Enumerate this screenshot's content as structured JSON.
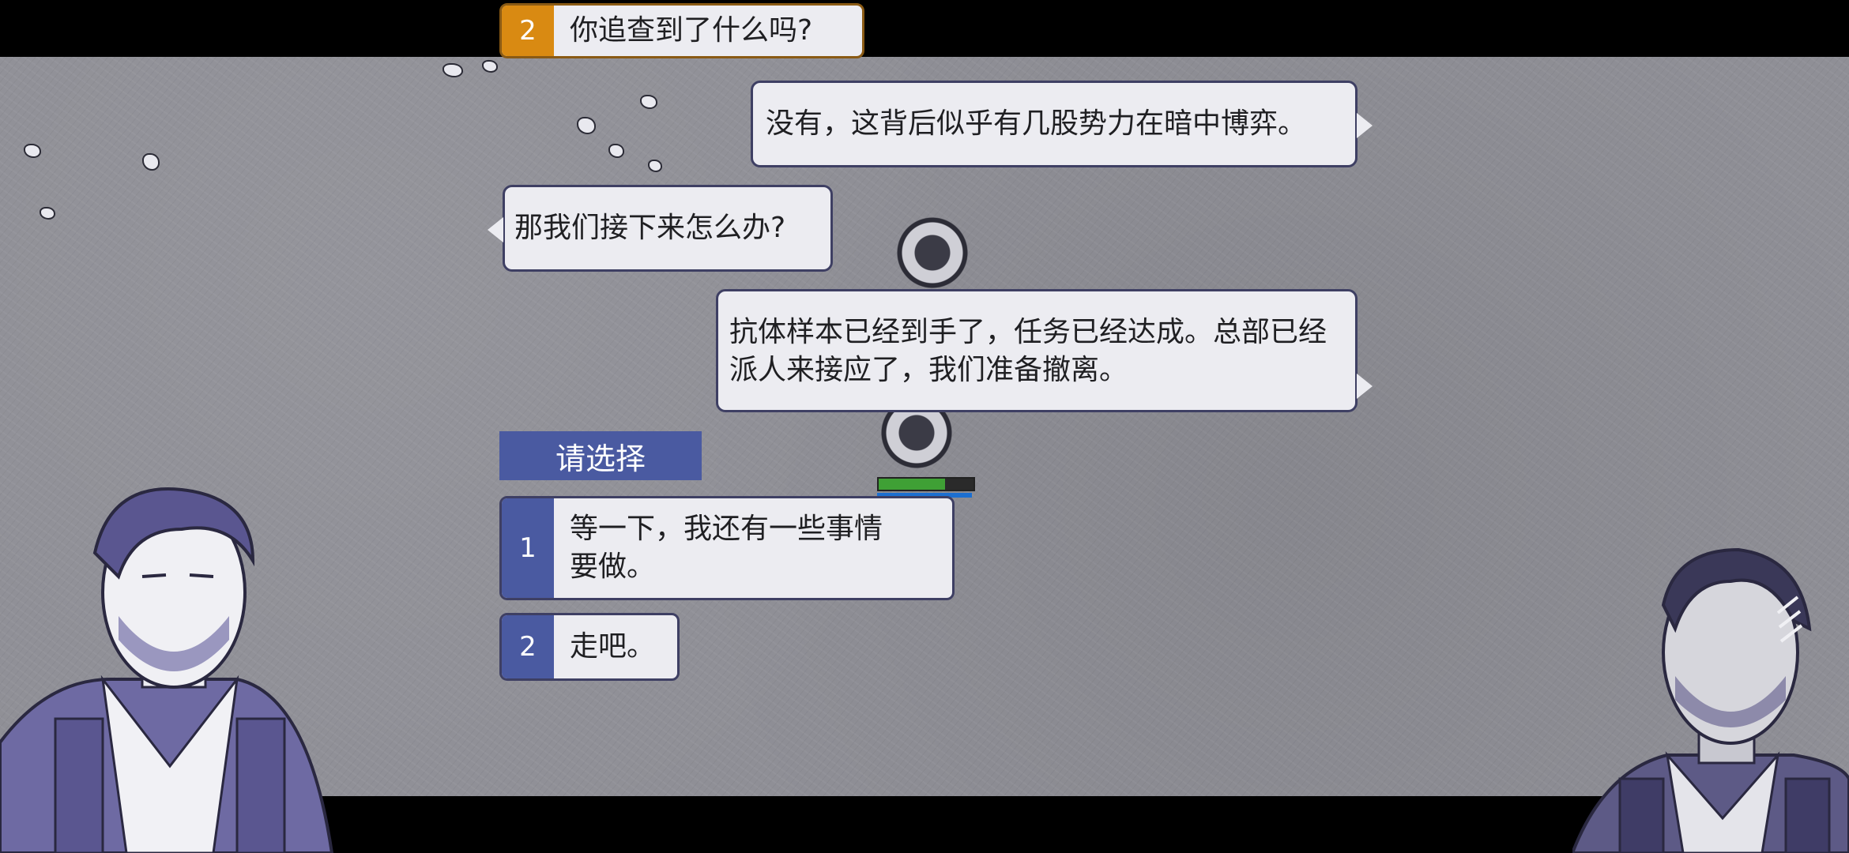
{
  "history_choice": {
    "number": "2",
    "text": "你追查到了什么吗?"
  },
  "dialogue": [
    {
      "speaker": "right",
      "text": "没有，这背后似乎有几股势力在暗中博弈。"
    },
    {
      "speaker": "left",
      "text": "那我们接下来怎么办?"
    },
    {
      "speaker": "right",
      "text": "抗体样本已经到手了，任务已经达成。总部已经派人来接应了，我们准备撤离。"
    }
  ],
  "choice_prompt": "请选择",
  "choices": [
    {
      "number": "1",
      "text": "等一下，我还有一些事情要做。"
    },
    {
      "number": "2",
      "text": "走吧。"
    }
  ],
  "player_health_fraction": 0.7,
  "colors": {
    "accent": "#4a5aa1",
    "history_accent": "#d98a12",
    "bubble": "#ececf1",
    "ground": "#8f8f96"
  }
}
